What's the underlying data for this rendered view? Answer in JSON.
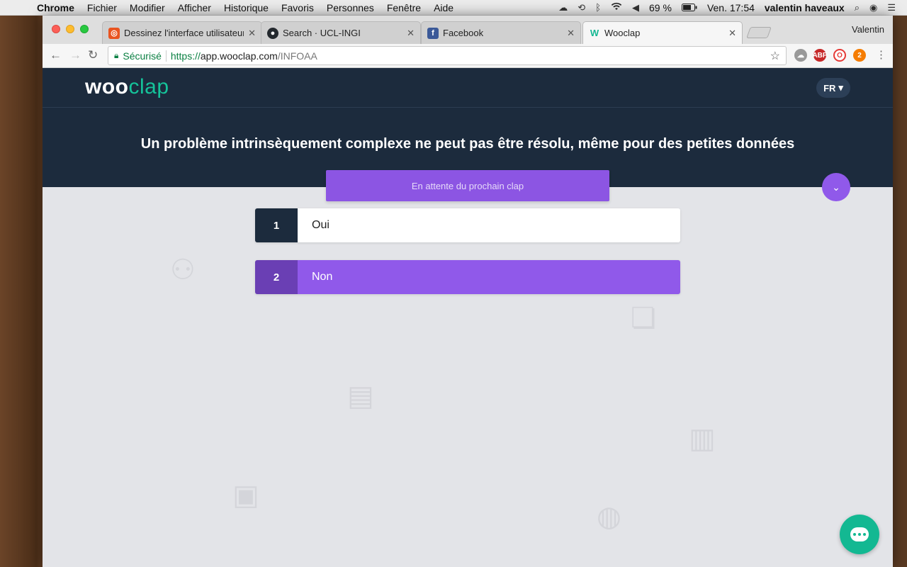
{
  "menubar": {
    "app": "Chrome",
    "items": [
      "Fichier",
      "Modifier",
      "Afficher",
      "Historique",
      "Favoris",
      "Personnes",
      "Fenêtre",
      "Aide"
    ],
    "battery": "69 %",
    "clock": "Ven. 17:54",
    "user": "valentin haveaux"
  },
  "browser": {
    "tabs": [
      {
        "title": "Dessinez l'interface utilisateur",
        "favicon": "ubuntu-icon",
        "color": "#e95420"
      },
      {
        "title": "Search · UCL-INGI",
        "favicon": "github-icon",
        "color": "#24292e"
      },
      {
        "title": "Facebook",
        "favicon": "facebook-icon",
        "color": "#3b5998"
      },
      {
        "title": "Wooclap",
        "favicon": "wooclap-icon",
        "color": "#13b892"
      }
    ],
    "profile": "Valentin",
    "secure_label": "Sécurisé",
    "url_scheme": "https://",
    "url_host": "app.wooclap.com",
    "url_path": "/INFOAA"
  },
  "page": {
    "logo_part1": "woo",
    "logo_part2": "clap",
    "language": "FR",
    "question": "Un problème intrinsèquement complexe ne peut pas être résolu, même pour des petites données",
    "waiting_text": "En attente du prochain clap",
    "answers": [
      {
        "number": "1",
        "label": "Oui",
        "selected": false
      },
      {
        "number": "2",
        "label": "Non",
        "selected": true
      }
    ]
  },
  "colors": {
    "header_bg": "#1c2b3d",
    "accent_purple": "#9059ea",
    "brand_green": "#13b892",
    "page_bg": "#e3e4e8"
  }
}
